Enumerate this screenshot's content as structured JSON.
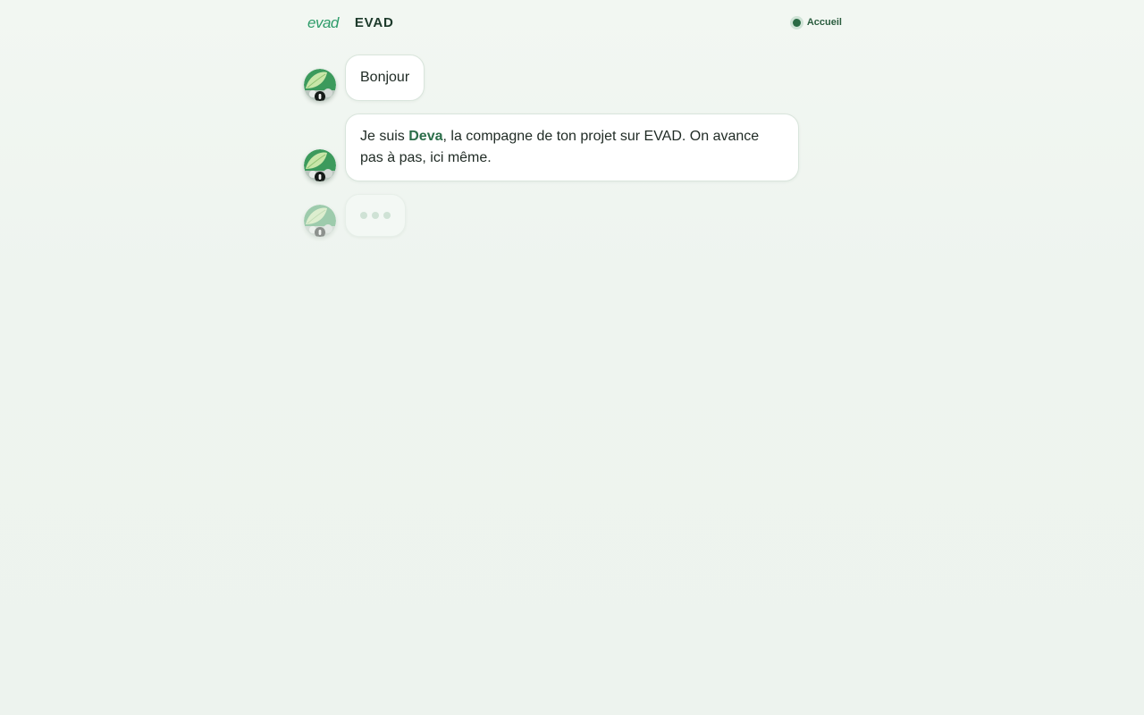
{
  "header": {
    "logo_text": "evad",
    "brand": "EVAD",
    "home_label": "Accueil",
    "home_icon": "status-dot-icon"
  },
  "messages": [
    {
      "sender": "assistant",
      "text": "Bonjour"
    },
    {
      "sender": "assistant",
      "text_before": "Je suis ",
      "highlight": "Deva",
      "text_after": ", la compagne de ton projet sur EVAD. On avance pas à pas, ici même."
    }
  ],
  "colors": {
    "accent": "#2c6e4a",
    "logo": "#2e9c6a",
    "background": "#eef4ef"
  }
}
